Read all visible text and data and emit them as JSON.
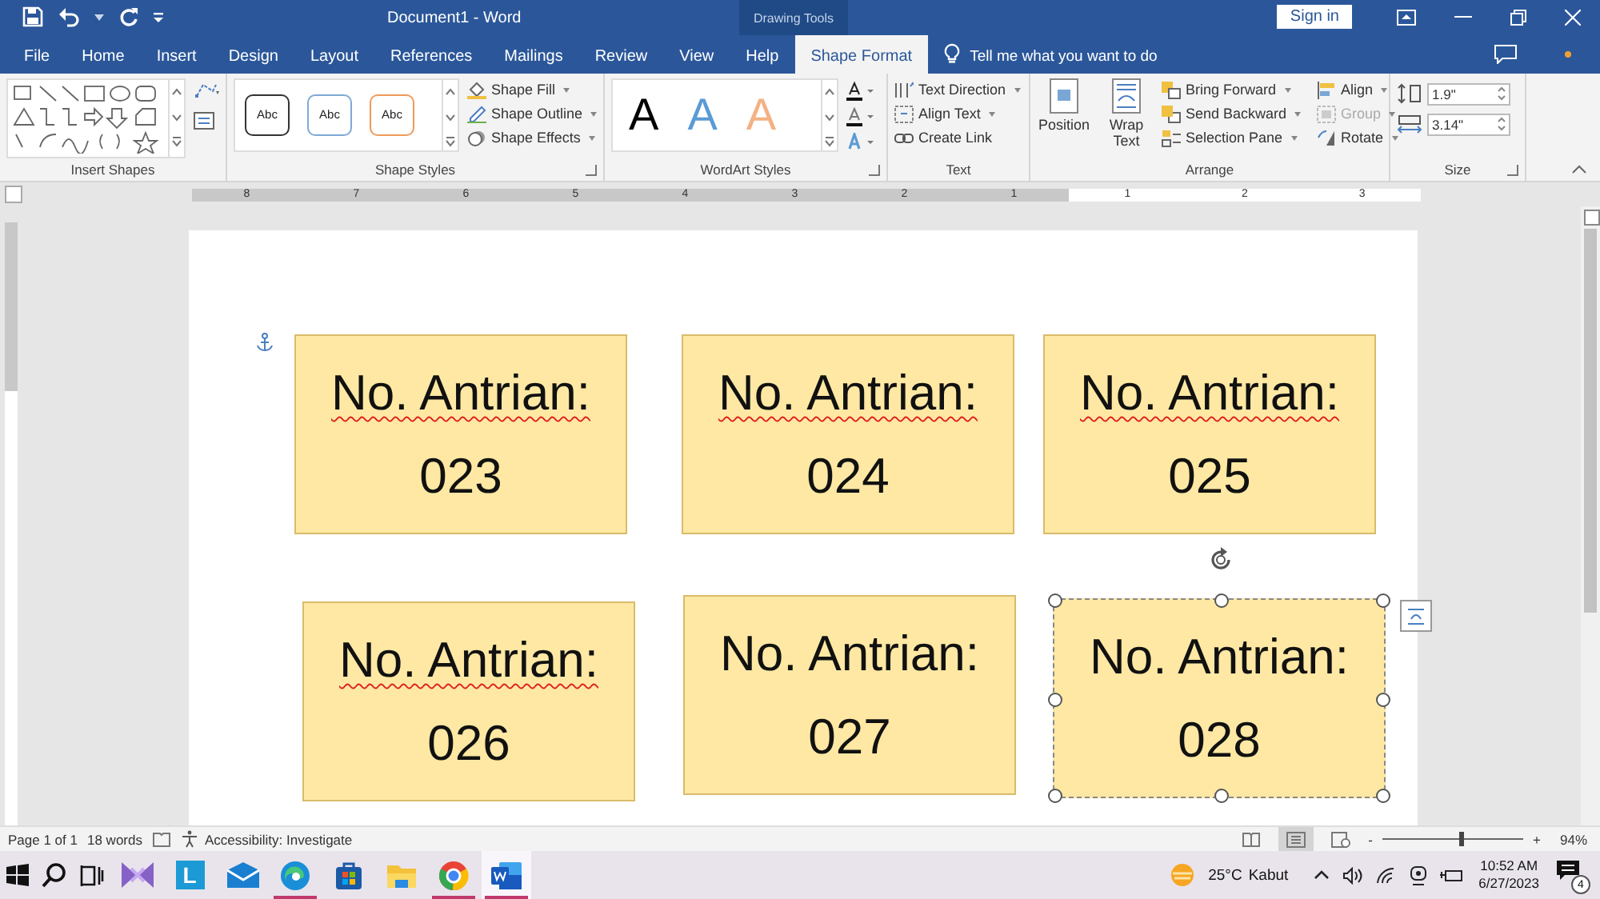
{
  "window": {
    "title": "Document1  -  Word",
    "context_label": "Drawing Tools",
    "sign_in": "Sign in"
  },
  "tabs": [
    {
      "label": "File",
      "selected": false
    },
    {
      "label": "Home",
      "selected": false
    },
    {
      "label": "Insert",
      "selected": false
    },
    {
      "label": "Design",
      "selected": false
    },
    {
      "label": "Layout",
      "selected": false
    },
    {
      "label": "References",
      "selected": false
    },
    {
      "label": "Mailings",
      "selected": false
    },
    {
      "label": "Review",
      "selected": false
    },
    {
      "label": "View",
      "selected": false
    },
    {
      "label": "Help",
      "selected": false
    },
    {
      "label": "Shape Format",
      "selected": true
    }
  ],
  "tell_me": "Tell me what you want to do",
  "ribbon": {
    "insert_shapes": {
      "label": "Insert Shapes"
    },
    "shape_styles": {
      "label": "Shape Styles",
      "samples": [
        {
          "text": "Abc",
          "color": "#333333"
        },
        {
          "text": "Abc",
          "color": "#7fa9d4"
        },
        {
          "text": "Abc",
          "color": "#ee9a5a"
        }
      ],
      "commands": [
        {
          "kind": "fill",
          "label": "Shape Fill"
        },
        {
          "kind": "outline",
          "label": "Shape Outline"
        },
        {
          "kind": "effects",
          "label": "Shape Effects"
        }
      ]
    },
    "wordart_styles": {
      "label": "WordArt Styles",
      "samples": [
        {
          "text": "A",
          "color": "#000000"
        },
        {
          "text": "A",
          "color": "#5b9bd5"
        },
        {
          "text": "A",
          "color": "#f4b183"
        }
      ]
    },
    "text": {
      "label": "Text",
      "commands": [
        {
          "kind": "direction",
          "label": "Text Direction"
        },
        {
          "kind": "align",
          "label": "Align Text"
        },
        {
          "kind": "link",
          "label": "Create Link"
        }
      ]
    },
    "arrange": {
      "label": "Arrange",
      "big": [
        {
          "kind": "position",
          "label": "Position"
        },
        {
          "kind": "wrap",
          "label": "Wrap Text"
        }
      ],
      "commands": [
        {
          "kind": "forward",
          "label": "Bring Forward",
          "disabled": false
        },
        {
          "kind": "backward",
          "label": "Send Backward",
          "disabled": false
        },
        {
          "kind": "pane",
          "label": "Selection Pane",
          "disabled": false
        },
        {
          "kind": "align",
          "label": "Align",
          "disabled": false
        },
        {
          "kind": "group",
          "label": "Group",
          "disabled": true
        },
        {
          "kind": "rotate",
          "label": "Rotate",
          "disabled": false
        }
      ]
    },
    "size": {
      "label": "Size",
      "height": "1.9\"",
      "width": "3.14\""
    }
  },
  "ruler": {
    "left_numbers": [
      "8",
      "7",
      "6",
      "5",
      "4",
      "3",
      "2",
      "1"
    ],
    "right_numbers": [
      "1",
      "2",
      "3"
    ]
  },
  "shapes": [
    {
      "title": "No. Antrian:",
      "number": "023",
      "spelling_flag": true,
      "selected": false
    },
    {
      "title": "No. Antrian:",
      "number": "024",
      "spelling_flag": true,
      "selected": false
    },
    {
      "title": "No. Antrian:",
      "number": "025",
      "spelling_flag": true,
      "selected": false
    },
    {
      "title": "No. Antrian:",
      "number": "026",
      "spelling_flag": true,
      "selected": false
    },
    {
      "title": "No. Antrian:",
      "number": "027",
      "spelling_flag": false,
      "selected": false
    },
    {
      "title": "No. Antrian:",
      "number": "028",
      "spelling_flag": false,
      "selected": true
    }
  ],
  "status_bar": {
    "page": "Page 1 of 1",
    "words": "18 words",
    "accessibility": "Accessibility: Investigate",
    "views": [
      {
        "kind": "read",
        "selected": false
      },
      {
        "kind": "print",
        "selected": true
      },
      {
        "kind": "web",
        "selected": false
      }
    ],
    "zoom": {
      "level": 0.55,
      "minus": "-",
      "plus": "+",
      "reading": "94%"
    }
  },
  "taskbar": {
    "apps": [
      {
        "kind": "vs",
        "running": false,
        "active": false
      },
      {
        "kind": "lync",
        "glyph": "L",
        "running": false,
        "active": false
      },
      {
        "kind": "mail",
        "running": false,
        "active": false
      },
      {
        "kind": "edge",
        "running": true,
        "active": false
      },
      {
        "kind": "store",
        "running": false,
        "active": false
      },
      {
        "kind": "explorer",
        "running": false,
        "active": false
      },
      {
        "kind": "chrome",
        "running": true,
        "active": false
      },
      {
        "kind": "word",
        "running": true,
        "active": true
      }
    ],
    "temperature": "25°C",
    "weather": "Kabut",
    "time": "10:52 AM",
    "date": "6/27/2023",
    "notifications": "4"
  }
}
